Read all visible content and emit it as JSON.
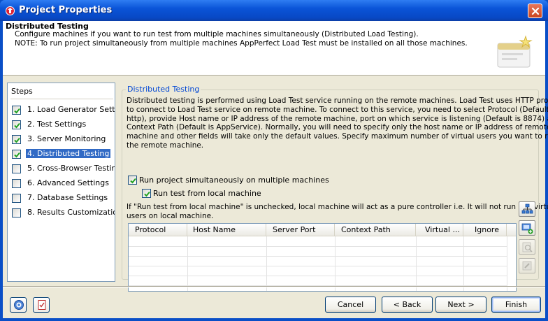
{
  "window": {
    "title": "Project Properties",
    "close_icon": "close-icon"
  },
  "header": {
    "title": "Distributed Testing",
    "lines": [
      "Configure machines if you want to run test from multiple machines simultaneously (Distributed Load Testing).",
      "NOTE: To run project simultaneously from multiple machines AppPerfect Load Test must be installed on all those machines."
    ]
  },
  "steps": {
    "title": "Steps",
    "items": [
      {
        "label": "1. Load Generator Settings",
        "checked": true
      },
      {
        "label": "2. Test Settings",
        "checked": true
      },
      {
        "label": "3. Server Monitoring",
        "checked": true
      },
      {
        "label": "4. Distributed Testing",
        "checked": true,
        "selected": true
      },
      {
        "label": "5. Cross-Browser Testing",
        "checked": false
      },
      {
        "label": "6. Advanced Settings",
        "checked": false
      },
      {
        "label": "7. Database Settings",
        "checked": false
      },
      {
        "label": "8. Results Customization",
        "checked": false
      }
    ]
  },
  "panel": {
    "group_title": "Distributed Testing",
    "description": [
      "Distributed testing is performed using Load Test service running on the remote machines. Load Test uses HTTP protocol",
      "to connect to Load Test service on remote machine. To connect to this service, you need to select Protocol (Default is",
      "http), provide Host name or IP address of the remote machine, port on which service is listening (Default is 8874) and",
      "Context Path (Default is AppService). Normally, you will need to specify only the host name or IP address of remote",
      "machine and other fields will take only the default values. Specify maximum number of virtual users you want to run on",
      "the remote machine."
    ],
    "run_simultaneously": {
      "label": "Run project simultaneously on multiple machines",
      "checked": true
    },
    "run_local": {
      "label": "Run test from local machine",
      "checked": true
    },
    "note": [
      "If \"Run test from local machine\" is unchecked, local machine will act as a pure controller i.e. It will not run any virtual",
      "users on local machine."
    ],
    "table": {
      "columns": [
        "Protocol",
        "Host Name",
        "Server Port",
        "Context Path",
        "Virtual ...",
        "Ignore"
      ],
      "rows": []
    },
    "side_buttons": [
      {
        "name": "network-icon",
        "enabled": true
      },
      {
        "name": "add-machine-icon",
        "enabled": true
      },
      {
        "name": "edit-icon",
        "enabled": false
      },
      {
        "name": "delete-icon",
        "enabled": false
      }
    ]
  },
  "footer": {
    "help_icon": "help-icon",
    "checklist_icon": "checklist-icon",
    "cancel": "Cancel",
    "back": "< Back",
    "next": "Next >",
    "finish": "Finish"
  },
  "colors": {
    "titlebar": "#0a54d8",
    "selection": "#316ac5",
    "group_title": "#0046d5",
    "dialog_bg": "#ece9d8"
  }
}
